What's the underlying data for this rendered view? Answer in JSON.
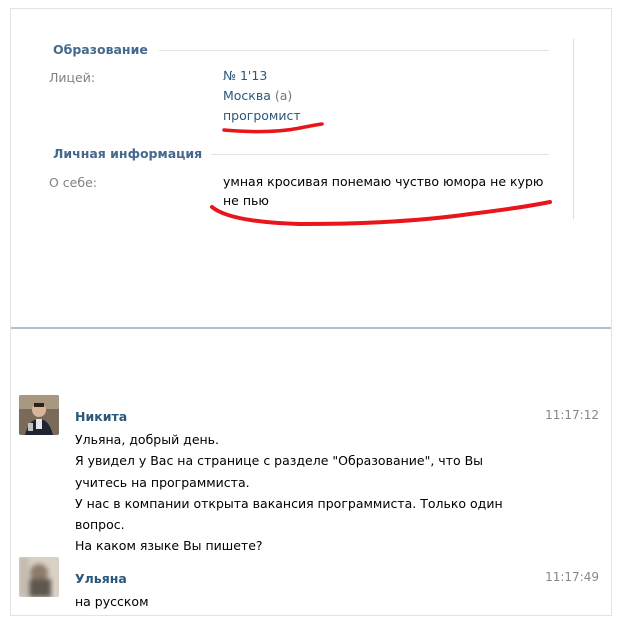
{
  "profile": {
    "education": {
      "title": "Образование",
      "school_label": "Лицей:",
      "school_name": "№ 1'13",
      "city": "Москва",
      "city_suffix": "(а)",
      "specialty": "прогромист"
    },
    "personal": {
      "title": "Личная информация",
      "about_label": "О себе:",
      "about_line1": "умная кросивая понемаю чуство юмора не курю",
      "about_line2": "не пью"
    }
  },
  "chat": {
    "messages": [
      {
        "author": "Никита",
        "time": "11:17:12",
        "lines": [
          "Ульяна, добрый день.",
          "Я увидел у Вас на странице с разделе \"Образование\", что Вы",
          "учитесь на программиста.",
          "У нас в компании открыта вакансия программиста. Только один",
          "вопрос.",
          "На каком языке Вы пишете?"
        ]
      },
      {
        "author": "Ульяна",
        "time": "11:17:49",
        "lines": [
          "на русском"
        ]
      }
    ]
  },
  "colors": {
    "accent": "#45688e",
    "link": "#2b587a",
    "divider": "#a7c3d8",
    "underline": "#e8151b"
  }
}
